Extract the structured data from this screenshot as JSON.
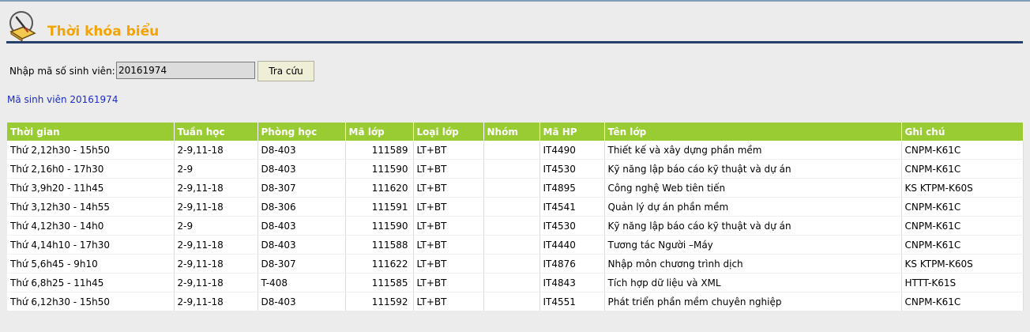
{
  "header": {
    "title": "Thời khóa biểu",
    "icon": "book-icon"
  },
  "search": {
    "label": "Nhập mã số sinh viên:",
    "value": "20161974",
    "button_label": "Tra cứu"
  },
  "student_line": "Mã sinh viên 20161974",
  "table": {
    "headers": [
      "Thời gian",
      "Tuần học",
      "Phòng học",
      "Mã lớp",
      "Loại lớp",
      "Nhóm",
      "Mã HP",
      "Tên lớp",
      "Ghi chú"
    ],
    "rows": [
      [
        "Thứ 2,12h30 - 15h50",
        "2-9,11-18",
        "D8-403",
        "111589",
        "LT+BT",
        "",
        "IT4490",
        "Thiết kế và xây dựng phần mềm",
        "CNPM-K61C"
      ],
      [
        "Thứ 2,16h0 - 17h30",
        "2-9",
        "D8-403",
        "111590",
        "LT+BT",
        "",
        "IT4530",
        "Kỹ năng lập báo cáo kỹ thuật và dự án",
        "CNPM-K61C"
      ],
      [
        "Thứ 3,9h20 - 11h45",
        "2-9,11-18",
        "D8-307",
        "111620",
        "LT+BT",
        "",
        "IT4895",
        "Công nghệ Web tiên tiến",
        "KS KTPM-K60S"
      ],
      [
        "Thứ 3,12h30 - 14h55",
        "2-9,11-18",
        "D8-306",
        "111591",
        "LT+BT",
        "",
        "IT4541",
        "Quản lý dự án phần mềm",
        "CNPM-K61C"
      ],
      [
        "Thứ 4,12h30 - 14h0",
        "2-9",
        "D8-403",
        "111590",
        "LT+BT",
        "",
        "IT4530",
        "Kỹ năng lập báo cáo kỹ thuật và dự án",
        "CNPM-K61C"
      ],
      [
        "Thứ 4,14h10 - 17h30",
        "2-9,11-18",
        "D8-403",
        "111588",
        "LT+BT",
        "",
        "IT4440",
        "Tương tác Người –Máy",
        "CNPM-K61C"
      ],
      [
        "Thứ 5,6h45 - 9h10",
        "2-9,11-18",
        "D8-307",
        "111622",
        "LT+BT",
        "",
        "IT4876",
        "Nhập môn chương trình dịch",
        "KS KTPM-K60S"
      ],
      [
        "Thứ 6,8h25 - 11h45",
        "2-9,11-18",
        "T-408",
        "111585",
        "LT+BT",
        "",
        "IT4843",
        "Tích hợp dữ liệu và XML",
        "HTTT-K61S"
      ],
      [
        "Thứ 6,12h30 - 15h50",
        "2-9,11-18",
        "D8-403",
        "111592",
        "LT+BT",
        "",
        "IT4551",
        "Phát triển phần mềm chuyên nghiệp",
        "CNPM-K61C"
      ]
    ]
  },
  "colors": {
    "title": "#f5a300",
    "title_rule": "#25416b",
    "table_header": "#99cc33",
    "student_link": "#1b2bd0"
  }
}
